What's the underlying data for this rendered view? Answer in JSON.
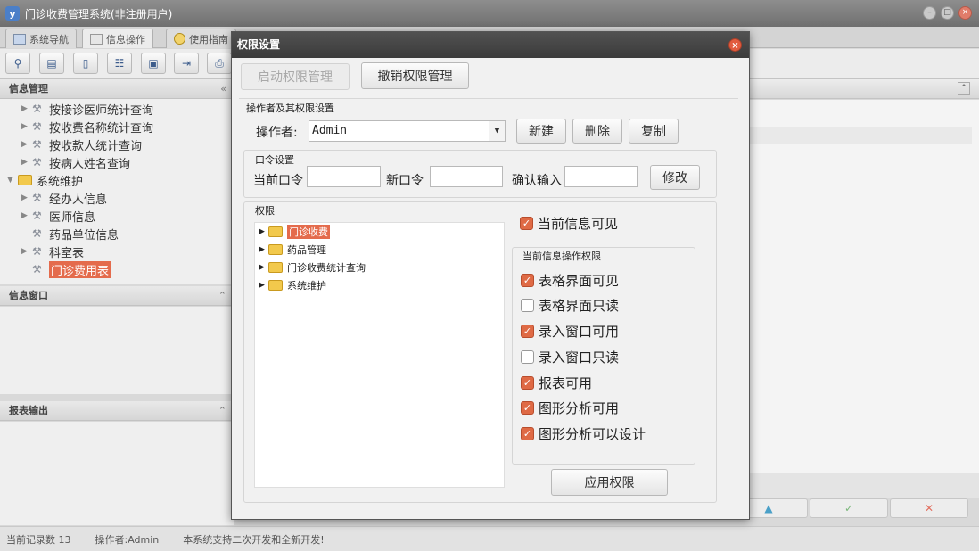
{
  "window": {
    "title": "门诊收费管理系统(非注册用户)",
    "icon_text": "y"
  },
  "tabs": [
    {
      "label": "系统导航",
      "active": false
    },
    {
      "label": "信息操作",
      "active": true
    },
    {
      "label": "使用指南",
      "active": false
    }
  ],
  "left": {
    "info_panel_title": "信息管理",
    "tree": [
      {
        "label": "按接诊医师统计查询",
        "level": 1,
        "expandable": true
      },
      {
        "label": "按收费名称统计查询",
        "level": 1,
        "expandable": true
      },
      {
        "label": "按收款人统计查询",
        "level": 1,
        "expandable": true
      },
      {
        "label": "按病人姓名查询",
        "level": 1,
        "expandable": true
      },
      {
        "label": "系统维护",
        "level": 0,
        "expandable": true,
        "folder": true
      },
      {
        "label": "经办人信息",
        "level": 1,
        "expandable": true
      },
      {
        "label": "医师信息",
        "level": 1,
        "expandable": true
      },
      {
        "label": "药品单位信息",
        "level": 1,
        "expandable": false
      },
      {
        "label": "科室表",
        "level": 1,
        "expandable": true
      },
      {
        "label": "门诊费用表",
        "level": 1,
        "expandable": false,
        "selected": true
      }
    ],
    "window_panel_title": "信息窗口",
    "report_panel_title": "报表输出"
  },
  "status": {
    "record_count": "当前记录数 13",
    "operator": "操作者:Admin",
    "message": "本系统支持二次开发和全新开发!"
  },
  "dialog": {
    "title": "权限设置",
    "start_btn": "启动权限管理",
    "revoke_btn": "撤销权限管理",
    "operator_section": "操作者及其权限设置",
    "operator_label": "操作者:",
    "operator_value": "Admin",
    "new_btn": "新建",
    "delete_btn": "删除",
    "copy_btn": "复制",
    "password_section": "口令设置",
    "current_pwd_label": "当前口令",
    "new_pwd_label": "新口令",
    "confirm_label": "确认输入",
    "modify_btn": "修改",
    "perm_section": "权限",
    "perm_tree": [
      {
        "label": "门诊收费",
        "selected": true
      },
      {
        "label": "药品管理",
        "selected": false
      },
      {
        "label": "门诊收费统计查询",
        "selected": false
      },
      {
        "label": "系统维护",
        "selected": false
      }
    ],
    "visible_label": "当前信息可见",
    "visible_checked": true,
    "ops_section": "当前信息操作权限",
    "ops": [
      {
        "label": "表格界面可见",
        "checked": true
      },
      {
        "label": "表格界面只读",
        "checked": false
      },
      {
        "label": "录入窗口可用",
        "checked": true
      },
      {
        "label": "录入窗口只读",
        "checked": false
      },
      {
        "label": "报表可用",
        "checked": true
      },
      {
        "label": "图形分析可用",
        "checked": true
      },
      {
        "label": "图形分析可以设计",
        "checked": true
      }
    ],
    "apply_btn": "应用权限"
  },
  "colors": {
    "accent": "#e46b4c",
    "title_bar": "#444444"
  }
}
